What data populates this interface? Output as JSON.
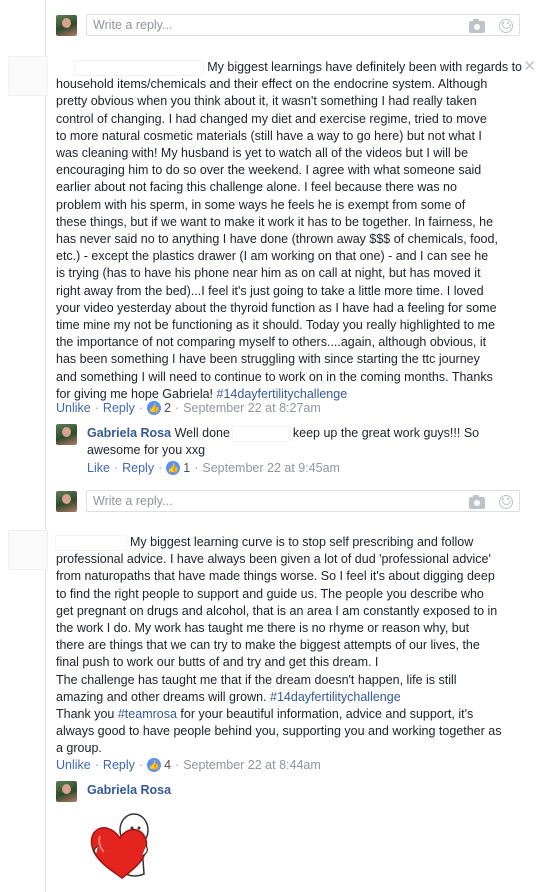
{
  "reply_placeholder": "Write a reply...",
  "close_glyph": "✕",
  "like_glyph": "👍",
  "separator": "·",
  "comment1": {
    "lines": [
      "My biggest learnings have definitely been with regards to",
      "household items/chemicals and their effect on the endocrine system. Although",
      "pretty obvious when you think about it, it wasn't something I had really taken",
      "control of changing. I had changed my diet and exercise regime, tried to move",
      "to more natural cosmetic materials (still have a way to go here) but not what I",
      "was cleaning with! My husband is yet to watch all of the videos but I will be",
      "encouraging him to do so over the weekend. I agree with what someone said",
      "earlier about not facing this challenge alone. I feel because there was no",
      "problem with his sperm, in some ways he feels he is exempt from some of",
      "these things, but if we want to make it work it has to be together. In fairness, he",
      "has never said no to anything I have done (thrown away $$$ of chemicals, food,",
      "etc.) - except the plastics drawer (I am working on that one) - and I can see he",
      "is trying (has to have his phone near him as on call at night, but has moved it",
      "right away from the bed)...I feel it's just going to take a little more time. I loved",
      "your video yesterday about the thyroid function as I have had a feeling for some",
      "time mine my not be functioning as it should. Today you really highlighted to me",
      "the importance of not comparing myself to others....again, although obvious, it",
      "has been something I have been struggling with since starting the ttc journey",
      "and something I will need to continue to work on in the coming months. Thanks"
    ],
    "last_line": "for giving me hope Gabriela!",
    "hashtag": "#14dayfertilitychallenge",
    "like_label": "Unlike",
    "reply_label": "Reply",
    "like_count": "2",
    "timestamp": "September 22 at 8:27am"
  },
  "reply1": {
    "author": "Gabriela Rosa",
    "text_before": "Well done",
    "text_after": "keep up the great work guys!!! So",
    "text_line2": "awesome for you xxg",
    "like_label": "Like",
    "reply_label": "Reply",
    "like_count": "1",
    "timestamp": "September 22 at 9:45am"
  },
  "comment2": {
    "first_line": "My biggest learning curve is to stop self prescribing and follow",
    "lines": [
      "professional advice. I have always been given a lot of dud 'professional advice'",
      "from naturopaths that have made things worse. So I feel it's about digging deep",
      "to find the right people to support and guide us. The people you describe who",
      "get pregnant on drugs and alcohol, that is an area I am constantly exposed to in",
      "the work I do. My work has taught me there is no rhyme or reason why, but",
      "there are things that we can try to make the biggest attempts of our lives, the",
      "final push to work our butts of and try and get this dream. I",
      "The challenge has taught me that if the dream doesn't happen, life is still"
    ],
    "line9_before": "amazing and other dreams will grown.",
    "hashtag1": "#14dayfertilitychallenge",
    "line10_before": "Thank you",
    "hashtag2": "#teamrosa",
    "line10_after": "for your beautiful information, advice and support, it's",
    "line11": "always good to have people behind you, supporting you and working together as",
    "line12": "a group.",
    "like_label": "Unlike",
    "reply_label": "Reply",
    "like_count": "4",
    "timestamp": "September 22 at 8:44am"
  },
  "reply2": {
    "author": "Gabriela Rosa",
    "sticker": "heart-hug-sticker"
  }
}
